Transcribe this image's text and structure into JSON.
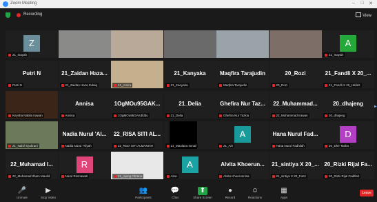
{
  "window": {
    "title": "Zoom Meeting",
    "controls": [
      "–",
      "□",
      "✕"
    ]
  },
  "topbar": {
    "recording_label": "Recording",
    "view_label": "View"
  },
  "tiles": [
    {
      "kind": "avatar",
      "name": "",
      "letter": "Z",
      "avatar_color": "#6b8e9b",
      "label": "21_Inayah"
    },
    {
      "kind": "video",
      "name": "",
      "label": "",
      "bg": "#8a8a88"
    },
    {
      "kind": "video",
      "name": "",
      "label": "",
      "bg": "#b8a999"
    },
    {
      "kind": "video",
      "name": "",
      "label": "",
      "bg": "#6a6a6a"
    },
    {
      "kind": "video",
      "name": "",
      "label": "",
      "bg": "#9aa4a8",
      "active": true
    },
    {
      "kind": "video",
      "name": "",
      "label": "",
      "bg": "#7d6f68"
    },
    {
      "kind": "avatar",
      "name": "",
      "letter": "A",
      "avatar_color": "#24a83a",
      "label": "21_Inayah"
    },
    {
      "kind": "name",
      "name": "Putri N",
      "label": "Putri N"
    },
    {
      "kind": "name",
      "name": "21_Zaidan Haza...",
      "label": "21_Zaidan Haza Zulaiq"
    },
    {
      "kind": "video",
      "name": "",
      "label": "21_Amira",
      "bg": "#c4b08c"
    },
    {
      "kind": "name",
      "name": "21_Kanyaka",
      "label": "21_Kanyaka"
    },
    {
      "kind": "name",
      "name": "Maqfira Tarajudin",
      "label": "Maqfira Tarajudin"
    },
    {
      "kind": "name",
      "name": "20_Rozi",
      "label": "20_Rozi"
    },
    {
      "kind": "name",
      "name": "21_Fandli X 20_...",
      "label": "21_Fandli X 20_Hafidz"
    },
    {
      "kind": "video",
      "name": "",
      "label": "Keysha Nabila Irawan",
      "bg": "#3b2418"
    },
    {
      "kind": "name",
      "name": "Annisa",
      "label": "Annisa"
    },
    {
      "kind": "name",
      "name": "1OgMOu95GAK...",
      "label": "1OgMOu95GAKdlddu"
    },
    {
      "kind": "name",
      "name": "21_Delia",
      "label": "21_Delia"
    },
    {
      "kind": "name",
      "name": "Ghefira Nur Taz...",
      "label": "Ghefira Nur Tazkia"
    },
    {
      "kind": "name",
      "name": "22_Muhammad...",
      "label": "22_Muhammad Irawan"
    },
    {
      "kind": "name",
      "name": "20_dhajeng",
      "label": "20_dhajeng"
    },
    {
      "kind": "video",
      "name": "",
      "label": "21_Nabil Syahrani",
      "bg": "#6b7b5a"
    },
    {
      "kind": "name",
      "name": "Nadia Nurul 'Al...",
      "label": "Nadia Nurul 'Aliyah"
    },
    {
      "kind": "name",
      "name": "22_RISA SITI AL...",
      "label": "22_RISA SITI ALMANIAH"
    },
    {
      "kind": "dark",
      "name": "",
      "label": "21_Maulana Ismail"
    },
    {
      "kind": "avatar",
      "name": "",
      "letter": "A",
      "avatar_color": "#1a9b9b",
      "label": "21_Ain"
    },
    {
      "kind": "name",
      "name": "Hana Nurul Fad...",
      "label": "Hana Nurul Fadhilah"
    },
    {
      "kind": "avatar",
      "name": "",
      "letter": "D",
      "avatar_color": "#b23fc4",
      "label": "20_Dhe Tasha"
    },
    {
      "kind": "name",
      "name": "22_Muhamad I...",
      "label": "22_Muhamad Ilham Maulid"
    },
    {
      "kind": "avatar",
      "name": "",
      "letter": "R",
      "avatar_color": "#e0457a",
      "label": "Nurul Rismawati"
    },
    {
      "kind": "video",
      "name": "",
      "label": "21_Ajeng Fitriana",
      "bg": "#e8e8e8"
    },
    {
      "kind": "avatar",
      "name": "",
      "letter": "A",
      "avatar_color": "#1ba3a3",
      "label": "Aina"
    },
    {
      "kind": "name",
      "name": "Alvita Khoerun...",
      "label": "Alvita Khoerunnisa"
    },
    {
      "kind": "name",
      "name": "21_sintiya X 20_...",
      "label": "21_sintiya X 20_Fazri"
    },
    {
      "kind": "name",
      "name": "20_Rizki Rijal Fa...",
      "label": "20_Rizki Rijal Fadillah"
    }
  ],
  "toolbar": [
    {
      "label": "Unmute",
      "icon": "microphone-icon",
      "glyph": "🎤"
    },
    {
      "label": "Stop Video",
      "icon": "video-icon",
      "glyph": "▶"
    },
    {
      "label": "Participants",
      "icon": "participants-icon",
      "glyph": "👥"
    },
    {
      "label": "Chat",
      "icon": "chat-icon",
      "glyph": "💬"
    },
    {
      "label": "Share Screen",
      "icon": "share-screen-icon",
      "glyph": "⬆"
    },
    {
      "label": "Record",
      "icon": "record-icon",
      "glyph": "●"
    },
    {
      "label": "Reactions",
      "icon": "reactions-icon",
      "glyph": "☺"
    },
    {
      "label": "Apps",
      "icon": "apps-icon",
      "glyph": "▦"
    }
  ],
  "leave_label": "Leave",
  "colors": {
    "accent": "#2d8cff",
    "share": "#22a346",
    "leave": "#e02828",
    "active_border": "#e8d54b"
  }
}
